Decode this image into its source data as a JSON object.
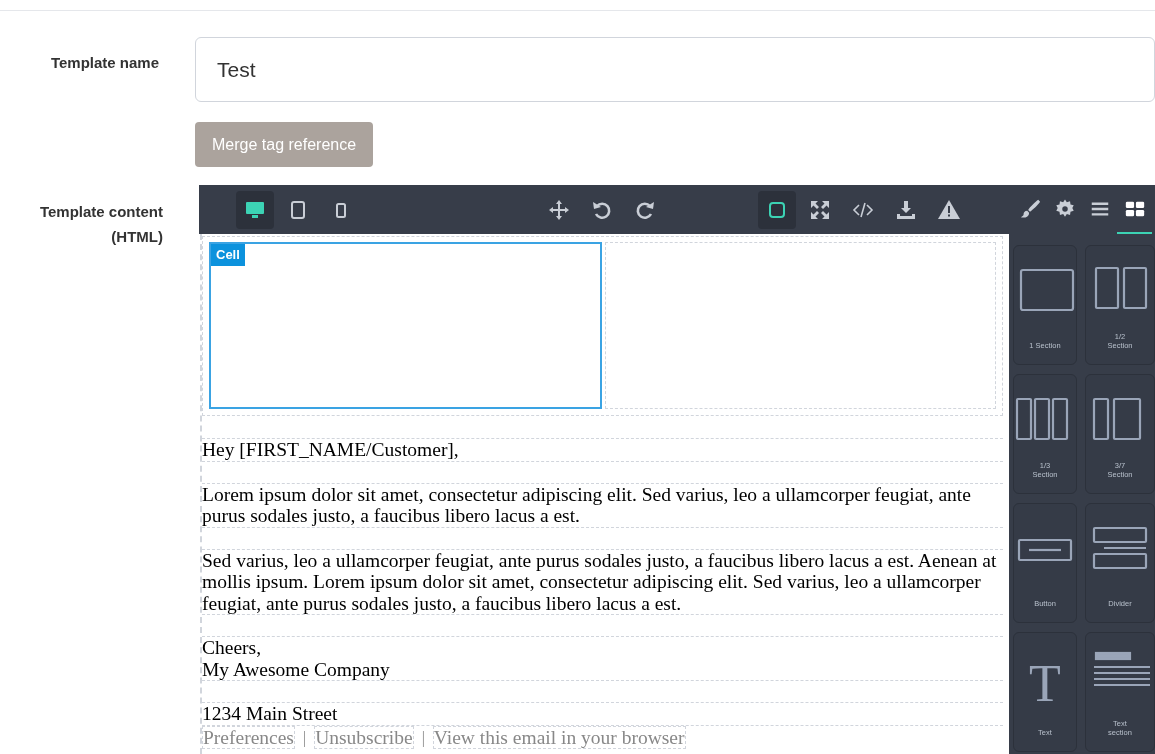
{
  "form": {
    "name_label": "Template name",
    "name_value": "Test",
    "merge_button": "Merge tag reference",
    "content_label": "Template content (HTML)"
  },
  "toolbar": {
    "devices": [
      {
        "kind": "desktop",
        "selected": true
      },
      {
        "kind": "tablet",
        "selected": false
      },
      {
        "kind": "mobile",
        "selected": false
      }
    ],
    "actions": [
      {
        "kind": "move"
      },
      {
        "kind": "undo"
      },
      {
        "kind": "redo"
      }
    ],
    "options": [
      {
        "kind": "borders",
        "selected": true
      },
      {
        "kind": "fullscreen",
        "selected": false
      },
      {
        "kind": "code",
        "selected": false
      },
      {
        "kind": "download",
        "selected": false
      },
      {
        "kind": "warning",
        "selected": false
      }
    ],
    "panel_tabs": [
      {
        "kind": "style",
        "selected": false
      },
      {
        "kind": "settings",
        "selected": false
      },
      {
        "kind": "layers",
        "selected": false
      },
      {
        "kind": "blocks",
        "selected": true
      }
    ]
  },
  "canvas": {
    "cells": [
      {
        "selected": true,
        "badge": "Cell"
      },
      {
        "selected": false
      }
    ],
    "paragraphs": [
      [
        "Hey [FIRST_NAME/Customer],"
      ],
      [
        "Lorem ipsum dolor sit amet, consectetur adipiscing elit. Sed varius, leo a ullamcorper feugiat, ante purus sodales justo, a faucibus libero lacus a est."
      ],
      [
        "Sed varius, leo a ullamcorper feugiat, ante purus sodales justo, a faucibus libero lacus a est. Aenean at mollis ipsum. Lorem ipsum dolor sit amet, consectetur adipiscing elit. Sed varius, leo a ullamcorper feugiat, ante purus sodales justo, a faucibus libero lacus a est."
      ],
      [
        "Cheers,",
        "My Awesome Company"
      ]
    ],
    "address": "1234 Main Street",
    "footer_items": [
      {
        "kind": "link",
        "text": "Preferences"
      },
      {
        "kind": "separator",
        "text": "|"
      },
      {
        "kind": "link",
        "text": "Unsubscribe"
      },
      {
        "kind": "separator",
        "text": "|"
      },
      {
        "kind": "link",
        "text": "View this email in your browser"
      }
    ]
  },
  "blocks": [
    {
      "kind": "section1",
      "label": "1 Section"
    },
    {
      "kind": "section2",
      "label": "1/2\nSection"
    },
    {
      "kind": "section3",
      "label": "1/3\nSection"
    },
    {
      "kind": "section37",
      "label": "3/7\nSection"
    },
    {
      "kind": "button",
      "label": "Button"
    },
    {
      "kind": "divider",
      "label": "Divider"
    },
    {
      "kind": "text",
      "label": "Text",
      "glyph": "T"
    },
    {
      "kind": "textsection",
      "label": "Text\nsection"
    }
  ]
}
